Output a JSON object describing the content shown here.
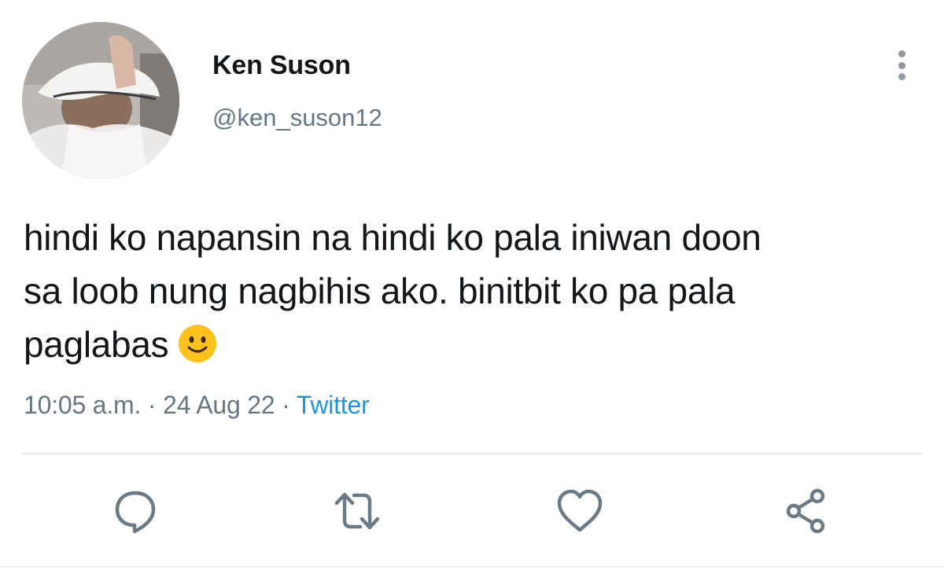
{
  "author": {
    "display_name": "Ken Suson",
    "handle": "@ken_suson12"
  },
  "tweet": {
    "text_lines": [
      "hindi ko napansin na hindi ko pala iniwan doon",
      "sa loob nung nagbihis ako. binitbit ko pa pala",
      "paglabas"
    ],
    "emoji": "slightly-smiling-face"
  },
  "meta": {
    "time": "10:05 a.m.",
    "separator": "·",
    "date": "24 Aug 22",
    "source": "Twitter"
  },
  "actions": [
    "reply-icon",
    "retweet-icon",
    "like-icon",
    "share-icon"
  ],
  "colors": {
    "text": "#14171a",
    "secondary": "#657786",
    "link": "#1b95e0",
    "icon": "#6b7a87",
    "divider": "#e1e6ea"
  }
}
